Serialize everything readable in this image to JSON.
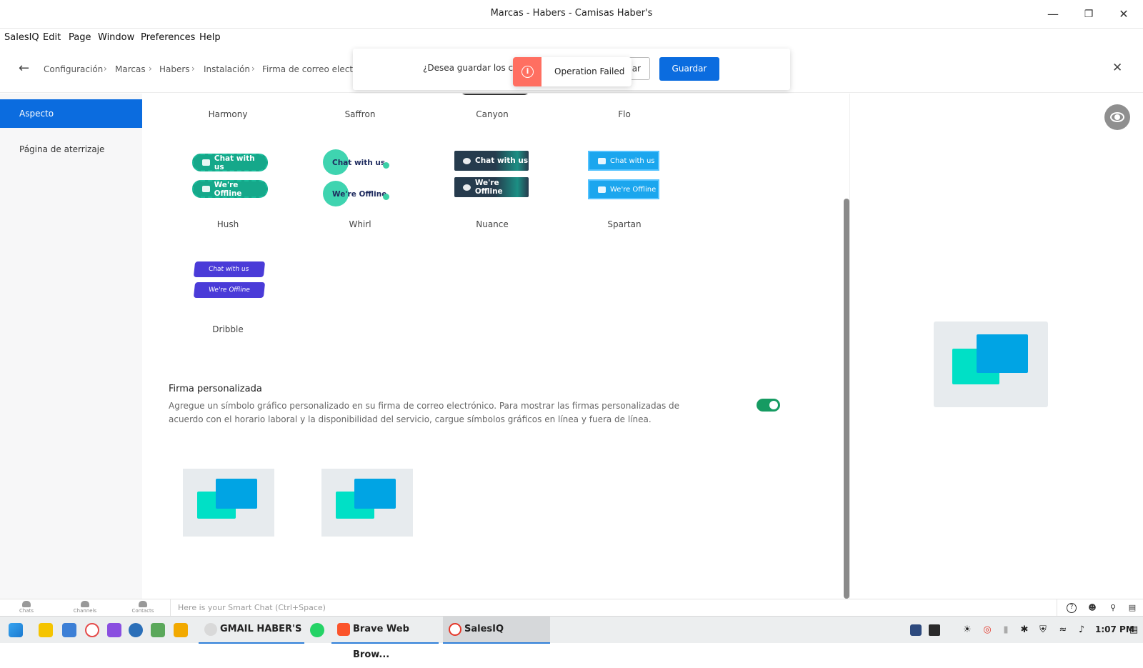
{
  "window": {
    "title": "Marcas - Habers - Camisas Haber's"
  },
  "menu": [
    "SalesIQ",
    "Edit",
    "Page",
    "Window",
    "Preferences",
    "Help"
  ],
  "breadcrumb": [
    "Configuración",
    "Marcas",
    "Habers",
    "Instalación",
    "Firma de correo electró"
  ],
  "save_dialog": {
    "question": "¿Desea guardar los cam",
    "cancel_label": "ar",
    "save_label": "Guardar"
  },
  "toast": {
    "message": "Operation Failed"
  },
  "sidebar": {
    "items": [
      {
        "label": "Aspecto",
        "active": true
      },
      {
        "label": "Página de aterrizaje",
        "active": false
      }
    ]
  },
  "styles": {
    "row1": [
      "Harmony",
      "Saffron",
      "Canyon",
      "Flo"
    ],
    "hush": {
      "label": "Hush",
      "online": "Chat with us",
      "offline": "We're Offline"
    },
    "whirl": {
      "label": "Whirl",
      "online": "Chat with us",
      "offline": "We're Offline"
    },
    "nuance": {
      "label": "Nuance",
      "online": "Chat with us",
      "offline": "We're Offline"
    },
    "spartan": {
      "label": "Spartan",
      "online": "Chat with us",
      "offline": "We're Offline"
    },
    "dribble": {
      "label": "Dribble",
      "online": "Chat with us",
      "offline": "We're Offline"
    }
  },
  "signature": {
    "title": "Firma personalizada",
    "description": "Agregue un símbolo gráfico personalizado en su firma de correo electrónico. Para mostrar las firmas personalizadas de acuerdo con el horario laboral y la disponibilidad del servicio, cargue símbolos gráficos en línea y fuera de línea.",
    "enabled": true
  },
  "appbar": {
    "nav": [
      "Chats",
      "Channels",
      "Contacts"
    ],
    "smartchat_placeholder": "Here is your Smart Chat (Ctrl+Space)"
  },
  "taskbar": {
    "tasks": [
      "GMAIL HABER'S",
      "Brave Web Brow...",
      "SalesIQ"
    ],
    "clock": "1:07 PM"
  },
  "colors": {
    "accent": "#0b6cdf",
    "toast_error": "#ff6f61",
    "toggle_on": "#169b62",
    "chat_teal": "#00e0c6",
    "chat_blue": "#00a4e4"
  }
}
